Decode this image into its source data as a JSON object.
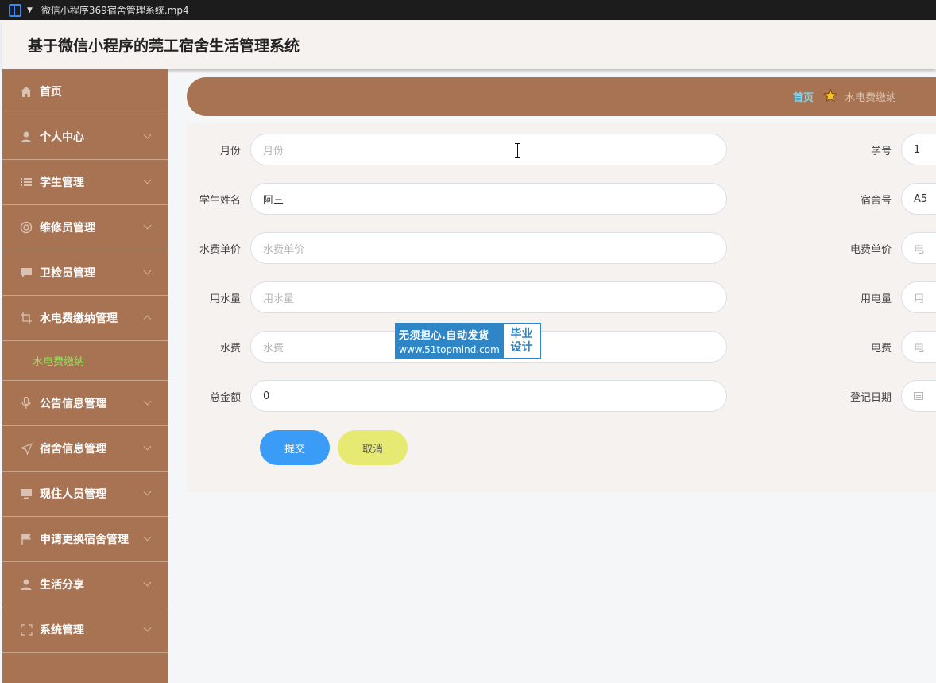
{
  "window": {
    "title": "微信小程序369宿舍管理系统.mp4"
  },
  "header": {
    "title": "基于微信小程序的莞工宿舍生活管理系统"
  },
  "sidebar": {
    "items": [
      {
        "label": "首页",
        "icon": "home-icon"
      },
      {
        "label": "个人中心",
        "icon": "user-icon"
      },
      {
        "label": "学生管理",
        "icon": "list-icon"
      },
      {
        "label": "维修员管理",
        "icon": "lifebuoy-icon"
      },
      {
        "label": "卫检员管理",
        "icon": "chat-icon"
      },
      {
        "label": "水电费缴纳管理",
        "icon": "crop-icon",
        "expanded": true
      },
      {
        "label": "公告信息管理",
        "icon": "microphone-icon"
      },
      {
        "label": "宿舍信息管理",
        "icon": "send-icon"
      },
      {
        "label": "现住人员管理",
        "icon": "monitor-icon"
      },
      {
        "label": "申请更换宿舍管理",
        "icon": "flag-icon"
      },
      {
        "label": "生活分享",
        "icon": "person-icon"
      },
      {
        "label": "系统管理",
        "icon": "fullscreen-icon"
      }
    ],
    "submenu": {
      "label": "水电费缴纳",
      "color": "#8fe05a"
    }
  },
  "breadcrumb": {
    "home": "首页",
    "current": "水电费缴纳"
  },
  "form": {
    "left": [
      {
        "label": "月份",
        "value": "",
        "placeholder": "月份"
      },
      {
        "label": "学生姓名",
        "value": "阿三",
        "placeholder": ""
      },
      {
        "label": "水费单价",
        "value": "",
        "placeholder": "水费单价"
      },
      {
        "label": "用水量",
        "value": "",
        "placeholder": "用水量"
      },
      {
        "label": "水费",
        "value": "",
        "placeholder": "水费"
      },
      {
        "label": "总金额",
        "value": "0",
        "placeholder": ""
      }
    ],
    "right": [
      {
        "label": "学号",
        "value": "1",
        "placeholder": ""
      },
      {
        "label": "宿舍号",
        "value": "A5",
        "placeholder": ""
      },
      {
        "label": "电费单价",
        "value": "",
        "placeholder": "电"
      },
      {
        "label": "用电量",
        "value": "",
        "placeholder": "用"
      },
      {
        "label": "电费",
        "value": "",
        "placeholder": "电"
      },
      {
        "label": "登记日期",
        "value": "",
        "placeholder": ""
      }
    ],
    "submit_label": "提交",
    "cancel_label": "取消"
  },
  "watermark": {
    "line1": "无须担心.自动发货",
    "line2": "www.51topmind.com",
    "badge1": "毕业",
    "badge2": "设计"
  },
  "colors": {
    "sidebar": "#a87352",
    "submit": "#3a9cf7",
    "cancel": "#e6e972",
    "breadcrumb_home": "#7fd6f2"
  }
}
